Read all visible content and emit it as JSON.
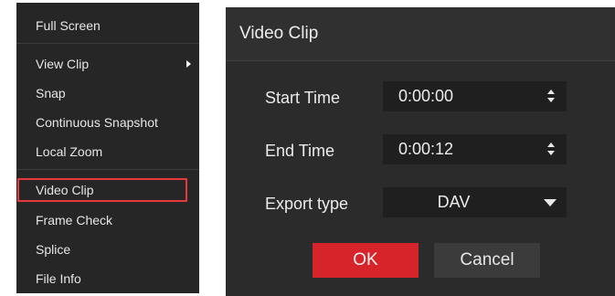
{
  "context_menu": {
    "items": [
      {
        "label": "Full Screen"
      },
      {
        "label": "View Clip"
      },
      {
        "label": "Snap"
      },
      {
        "label": "Continuous Snapshot"
      },
      {
        "label": "Local Zoom"
      },
      {
        "label": "Video Clip"
      },
      {
        "label": "Frame Check"
      },
      {
        "label": "Splice"
      },
      {
        "label": "File Info"
      }
    ],
    "highlight_color": "#e23a3a"
  },
  "dialog": {
    "title": "Video Clip",
    "start_time": {
      "label": "Start Time",
      "value": "0:00:00"
    },
    "end_time": {
      "label": "End Time",
      "value": "0:00:12"
    },
    "export_type": {
      "label": "Export type",
      "value": "DAV"
    },
    "ok_label": "OK",
    "cancel_label": "Cancel",
    "accent_color": "#d6242a"
  }
}
